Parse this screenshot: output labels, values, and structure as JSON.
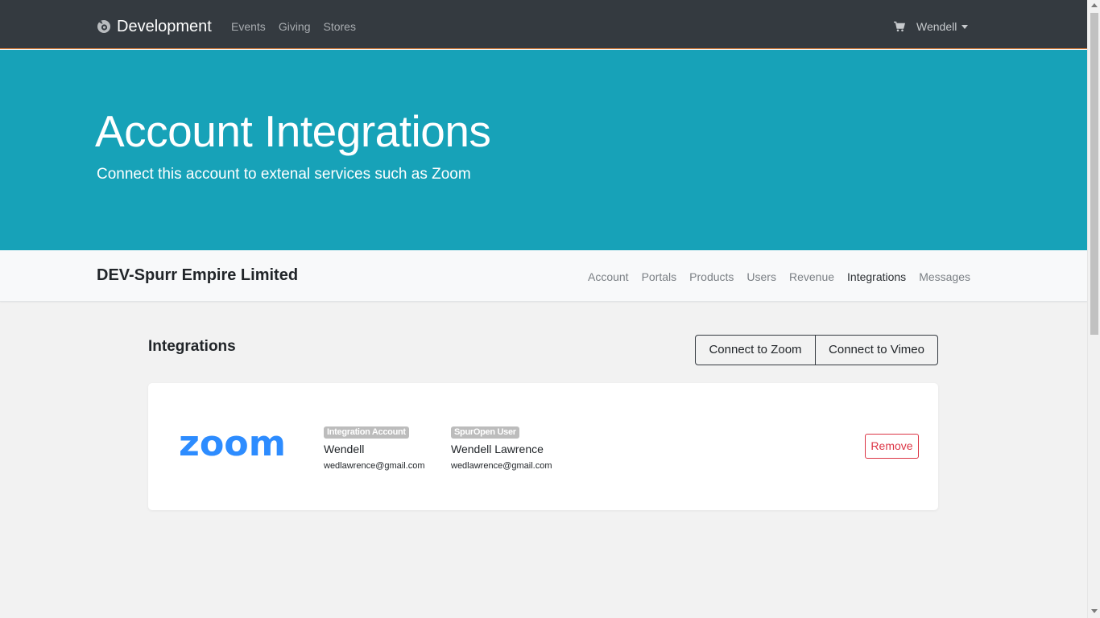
{
  "navbar": {
    "brand": "Development",
    "links": [
      "Events",
      "Giving",
      "Stores"
    ],
    "user": "Wendell"
  },
  "hero": {
    "title": "Account Integrations",
    "subtitle": "Connect this account to extenal services such as Zoom"
  },
  "subbar": {
    "org_name": "DEV-Spurr Empire Limited",
    "links": [
      "Account",
      "Portals",
      "Products",
      "Users",
      "Revenue",
      "Integrations",
      "Messages"
    ],
    "active": "Integrations"
  },
  "integrations": {
    "title": "Integrations",
    "connect_zoom": "Connect to Zoom",
    "connect_vimeo": "Connect to Vimeo",
    "items": [
      {
        "service_logo": "zoom-logo",
        "service_logo_text": "zoom",
        "integration_account_label": "Integration Account",
        "integration_account_name": "Wendell",
        "integration_account_email": "wedlawrence@gmail.com",
        "user_label": "SpurOpen User",
        "user_name": "Wendell Lawrence",
        "user_email": "wedlawrence@gmail.com",
        "remove_label": "Remove"
      }
    ]
  },
  "colors": {
    "navbar_bg": "#343a40",
    "hero_bg": "#17a2b8",
    "zoom_blue": "#2d8cff",
    "danger": "#dc3545"
  }
}
